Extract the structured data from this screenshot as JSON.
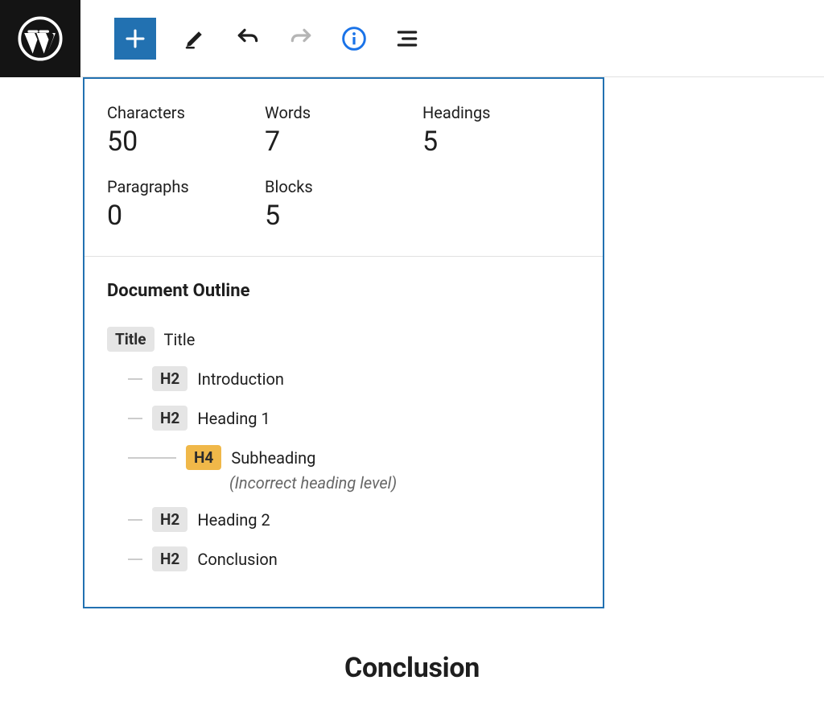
{
  "toolbar": {
    "icons": {
      "add": "add-block",
      "edit": "edit-pencil",
      "undo": "undo",
      "redo": "redo",
      "info": "info",
      "list": "outline-list"
    }
  },
  "stats": {
    "characters": {
      "label": "Characters",
      "value": "50"
    },
    "words": {
      "label": "Words",
      "value": "7"
    },
    "headings": {
      "label": "Headings",
      "value": "5"
    },
    "paragraphs": {
      "label": "Paragraphs",
      "value": "0"
    },
    "blocks": {
      "label": "Blocks",
      "value": "5"
    }
  },
  "outline": {
    "title": "Document Outline",
    "items": [
      {
        "level": "Title",
        "text": "Title",
        "warn": false,
        "indent": 1,
        "connector": false
      },
      {
        "level": "H2",
        "text": "Introduction",
        "warn": false,
        "indent": 2,
        "connector": true
      },
      {
        "level": "H2",
        "text": "Heading 1",
        "warn": false,
        "indent": 2,
        "connector": true
      },
      {
        "level": "H4",
        "text": "Subheading",
        "warn": true,
        "indent": 3,
        "connector": true,
        "note": "(Incorrect heading level)"
      },
      {
        "level": "H2",
        "text": "Heading 2",
        "warn": false,
        "indent": 2,
        "connector": true
      },
      {
        "level": "H2",
        "text": "Conclusion",
        "warn": false,
        "indent": 2,
        "connector": true
      }
    ]
  },
  "content": {
    "visible_heading": "Conclusion"
  }
}
